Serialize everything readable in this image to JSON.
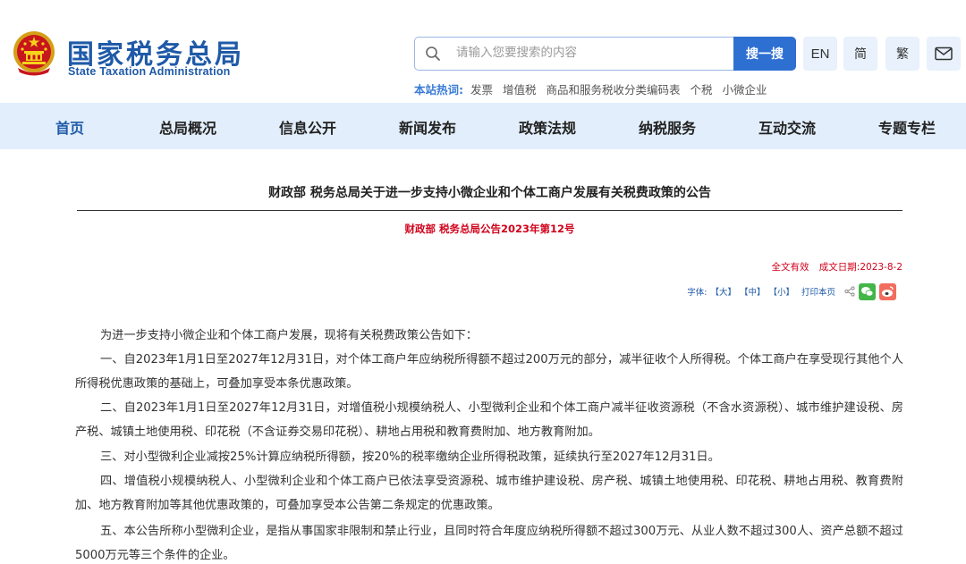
{
  "header": {
    "site_title": "国家税务总局",
    "site_subtitle": "State Taxation Administration",
    "search": {
      "placeholder": "请输入您要搜索的内容",
      "button_label": "搜一搜"
    },
    "lang": {
      "en": "EN",
      "simplified": "简",
      "traditional": "繁"
    },
    "hotwords": {
      "label": "本站热词:",
      "items": [
        "发票",
        "增值税",
        "商品和服务税收分类编码表",
        "个税",
        "小微企业"
      ]
    }
  },
  "nav": {
    "items": [
      "首页",
      "总局概况",
      "信息公开",
      "新闻发布",
      "政策法规",
      "纳税服务",
      "互动交流",
      "专题专栏"
    ]
  },
  "article": {
    "title": "财政部 税务总局关于进一步支持小微企业和个体工商户发展有关税费政策的公告",
    "number": "财政部 税务总局公告2023年第12号",
    "validity": "全文有效",
    "date": "成文日期:2023-8-2",
    "tools": {
      "font_label": "字体:",
      "large": "【大】",
      "medium": "【中】",
      "small": "【小】",
      "print": "打印本页"
    },
    "paragraphs": [
      "为进一步支持小微企业和个体工商户发展，现将有关税费政策公告如下：",
      "一、自2023年1月1日至2027年12月31日，对个体工商户年应纳税所得额不超过200万元的部分，减半征收个人所得税。个体工商户在享受现行其他个人所得税优惠政策的基础上，可叠加享受本条优惠政策。",
      "二、自2023年1月1日至2027年12月31日，对增值税小规模纳税人、小型微利企业和个体工商户减半征收资源税（不含水资源税）、城市维护建设税、房产税、城镇土地使用税、印花税（不含证券交易印花税）、耕地占用税和教育费附加、地方教育附加。",
      "三、对小型微利企业减按25%计算应纳税所得额，按20%的税率缴纳企业所得税政策，延续执行至2027年12月31日。",
      "四、增值税小规模纳税人、小型微利企业和个体工商户已依法享受资源税、城市维护建设税、房产税、城镇土地使用税、印花税、耕地占用税、教育费附加、地方教育附加等其他优惠政策的，可叠加享受本公告第二条规定的优惠政策。",
      "五、本公告所称小型微利企业，是指从事国家非限制和禁止行业，且同时符合年度应纳税所得额不超过300万元、从业人数不超过300人、资产总额不超过5000万元等三个条件的企业。"
    ]
  },
  "colors": {
    "brand_blue": "#1f5aa8",
    "search_button": "#2e6fd2",
    "nav_background": "#e2eefb",
    "accent_red": "#d0021b",
    "wechat_green": "#44b549",
    "weibo_red": "#f26d5f"
  },
  "icons": {
    "emblem": "national-emblem-icon",
    "search": "search-icon",
    "mail": "mail-icon",
    "share": "share-icon",
    "wechat": "wechat-icon",
    "weibo": "weibo-icon"
  }
}
